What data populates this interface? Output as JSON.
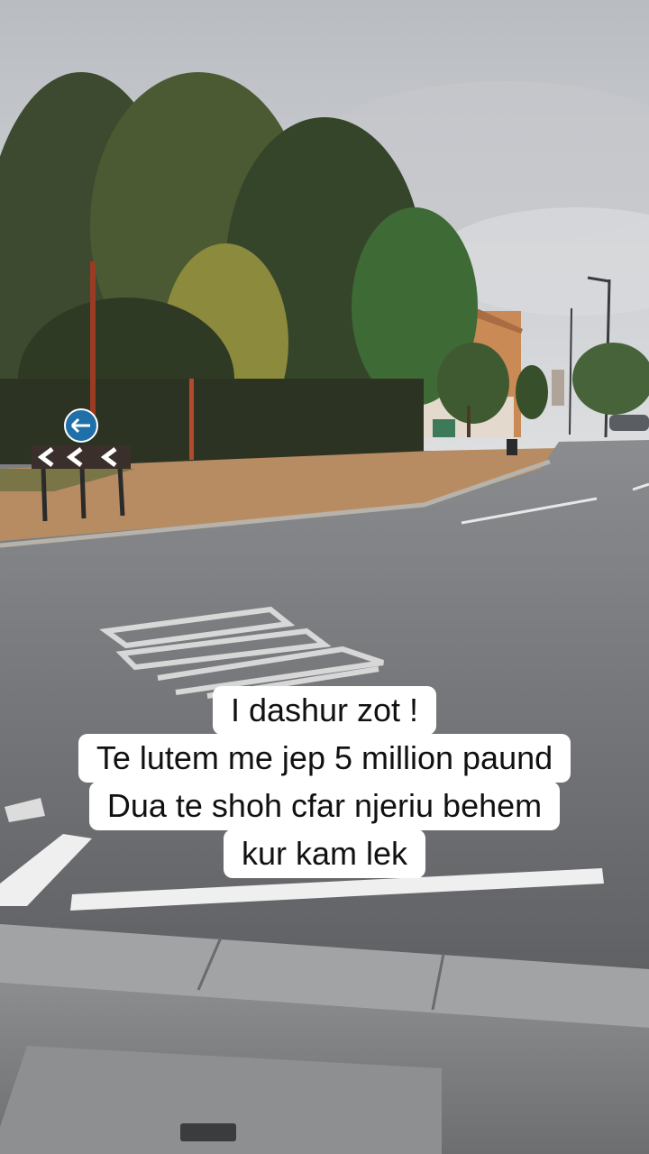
{
  "caption": {
    "lines": [
      "I dashur zot !",
      "Te lutem me jep 5 million paund",
      "Dua te shoh cfar njeriu behem",
      "kur kam lek"
    ]
  },
  "colors": {
    "sky": "#d3d5d8",
    "asphalt": "#6f7174",
    "grass": "#b98a5e",
    "caption_bg": "#ffffff",
    "caption_text": "#111111"
  },
  "icons": [
    "keep-left-sign-icon",
    "chevron-sign-icon"
  ]
}
